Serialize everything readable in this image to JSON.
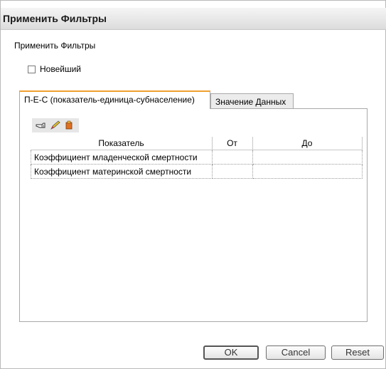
{
  "window": {
    "title": "Применить Фильтры"
  },
  "section": {
    "title": "Применить Фильтры"
  },
  "checkbox": {
    "label": "Новейший",
    "checked": false
  },
  "tabs": [
    {
      "label": "П-Е-С (показатель-единица-субнаселение)",
      "active": true
    },
    {
      "label": "Значение Данных",
      "active": false
    }
  ],
  "toolbar": {
    "icons": [
      "hand-pointer-icon",
      "pencil-icon",
      "clear-icon"
    ]
  },
  "table": {
    "headers": [
      "Показатель",
      "От",
      "До"
    ],
    "rows": [
      [
        "Коэффициент младенческой смертности",
        "",
        ""
      ],
      [
        "Коэффициент материнской смертности",
        "",
        ""
      ]
    ]
  },
  "buttons": {
    "ok": "OK",
    "cancel": "Cancel",
    "reset": "Reset"
  }
}
